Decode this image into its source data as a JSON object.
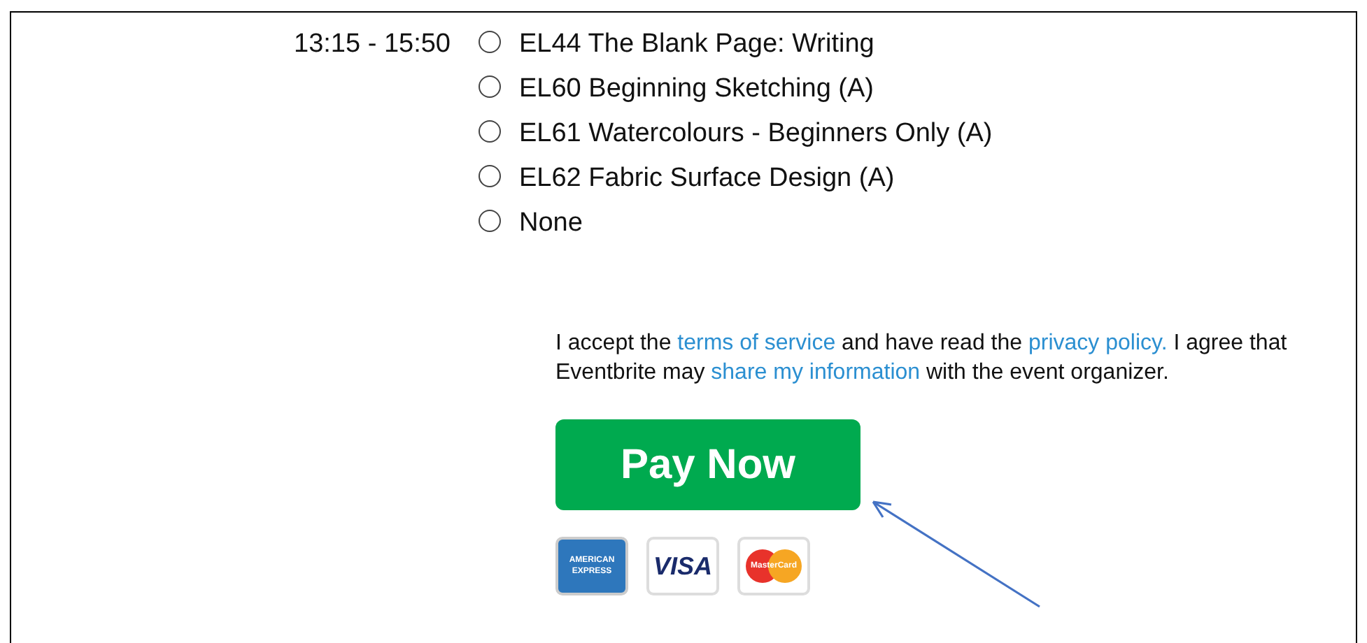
{
  "session": {
    "time": "13:15 - 15:50",
    "options": [
      {
        "label": "EL44 The Blank Page: Writing",
        "selected": false
      },
      {
        "label": "EL60 Beginning Sketching (A)",
        "selected": false
      },
      {
        "label": "EL61 Watercolours - Beginners Only (A)",
        "selected": false
      },
      {
        "label": "EL62 Fabric Surface Design (A)",
        "selected": false
      },
      {
        "label": "None",
        "selected": false
      }
    ]
  },
  "consent": [
    {
      "kind": "text",
      "text": "I accept the "
    },
    {
      "kind": "link",
      "text": "terms of service"
    },
    {
      "kind": "text",
      "text": " and have read the "
    },
    {
      "kind": "link",
      "text": "privacy policy."
    },
    {
      "kind": "text",
      "text": " I agree that Eventbrite may "
    },
    {
      "kind": "link",
      "text": "share my information"
    },
    {
      "kind": "text",
      "text": " with the event organizer."
    }
  ],
  "pay_button": "Pay Now",
  "cards": [
    {
      "kind": "amex",
      "text": "AMERICAN EXPRESS"
    },
    {
      "kind": "visa",
      "text": "VISA"
    },
    {
      "kind": "mastercard",
      "text": "MasterCard"
    }
  ]
}
